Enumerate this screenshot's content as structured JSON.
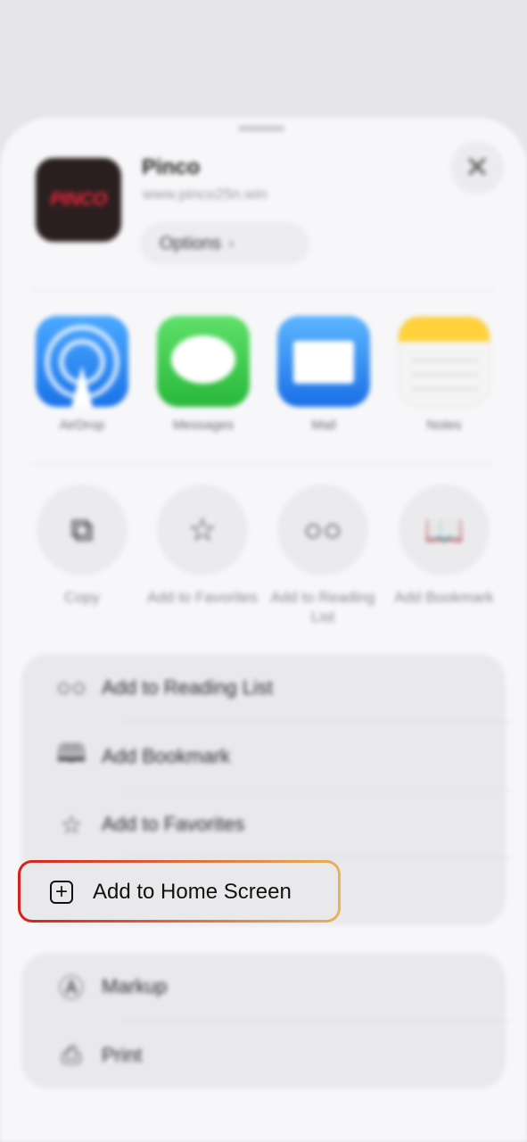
{
  "app": {
    "name": "Pinco",
    "url": "www.pinco25n.win",
    "logo_text": "PINCO",
    "options_label": "Options",
    "options_chevron": "›",
    "close_glyph": "✕"
  },
  "share_targets": [
    {
      "label": "AirDrop",
      "icon": "airdrop-icon"
    },
    {
      "label": "Messages",
      "icon": "messages-icon"
    },
    {
      "label": "Mail",
      "icon": "mail-icon"
    },
    {
      "label": "Notes",
      "icon": "notes-icon"
    }
  ],
  "actions": [
    {
      "label": "Copy",
      "icon": "copy-icon",
      "glyph": "⧉"
    },
    {
      "label": "Add to Favorites",
      "icon": "star-icon",
      "glyph": "☆"
    },
    {
      "label": "Add to Reading List",
      "icon": "glasses-icon",
      "glyph": "○○"
    },
    {
      "label": "Add Bookmark",
      "icon": "book-icon",
      "glyph": "📖"
    }
  ],
  "list_group_1": [
    {
      "label": "Add to Reading List",
      "icon": "glasses-icon",
      "glyph": "○○"
    },
    {
      "label": "Add Bookmark",
      "icon": "book-icon",
      "glyph": "🕮"
    },
    {
      "label": "Add to Favorites",
      "icon": "star-icon",
      "glyph": "☆"
    }
  ],
  "highlighted_row": {
    "label": "Add to Home Screen",
    "icon": "plus-square-icon",
    "glyph": "+"
  },
  "list_group_2": [
    {
      "label": "Markup",
      "icon": "markup-icon",
      "glyph": "Ⓐ"
    },
    {
      "label": "Print",
      "icon": "printer-icon",
      "glyph": "⎙"
    }
  ],
  "colors": {
    "highlight_gradient_start": "#d81f1f",
    "highlight_gradient_end": "#e6b35a"
  }
}
